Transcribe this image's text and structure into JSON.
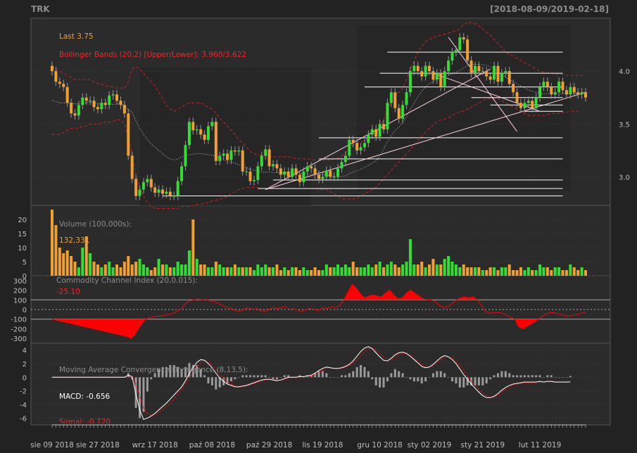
{
  "symbol": "TRK",
  "date_range": "[2018-08-09/2019-02-18]",
  "colors": {
    "bg": "#222222",
    "panel": "#2b2b2b",
    "grid": "#3a3a3a",
    "axis": "#bfbfbf",
    "up": "#33dd33",
    "down": "#f0a030",
    "band": "#cc2222",
    "red": "#ff0000",
    "orange": "#f0a030",
    "white": "#ffffff",
    "gray": "#8c8c8c"
  },
  "legend": {
    "last": "Last 3.75",
    "bbands": "Bollinger Bands (20,2) [Upper/Lower]: 3.960/3.622",
    "volume_title": "Volume (100,000s):",
    "volume_value": "132,331",
    "cci_title": "Commodity Channel Index (20,0.015):",
    "cci_value": "-25.10",
    "macd_title": "Moving Average Convergence Divergence (8,13,5):",
    "macd_value": "MACD: -0.656",
    "signal_value": "Signal: -0.720"
  },
  "x_axis_labels": [
    {
      "label": "sie 09 2018",
      "i": 0
    },
    {
      "label": "sie 27 2018",
      "i": 12
    },
    {
      "label": "wrz 17 2018",
      "i": 27
    },
    {
      "label": "paź 08 2018",
      "i": 42
    },
    {
      "label": "paź 29 2018",
      "i": 57
    },
    {
      "label": "lis 19 2018",
      "i": 71
    },
    {
      "label": "gru 10 2018",
      "i": 86
    },
    {
      "label": "sty 02 2019",
      "i": 99
    },
    {
      "label": "sty 21 2019",
      "i": 113
    },
    {
      "label": "lut 11 2019",
      "i": 128
    }
  ],
  "chart_data": [
    {
      "type": "candlestick",
      "name": "price",
      "ylim": [
        2.73,
        4.5
      ],
      "yticks": [
        3.0,
        3.5,
        4.0
      ],
      "ohlc_closes": [
        4.0,
        3.9,
        3.88,
        3.85,
        3.7,
        3.6,
        3.58,
        3.68,
        3.75,
        3.72,
        3.72,
        3.66,
        3.64,
        3.7,
        3.68,
        3.77,
        3.78,
        3.72,
        3.68,
        3.6,
        3.2,
        2.98,
        2.82,
        2.88,
        2.95,
        2.98,
        2.9,
        2.85,
        2.88,
        2.84,
        2.86,
        2.82,
        2.82,
        2.96,
        3.1,
        3.3,
        3.52,
        3.44,
        3.45,
        3.4,
        3.35,
        3.48,
        3.52,
        3.15,
        3.2,
        3.22,
        3.16,
        3.25,
        3.24,
        3.25,
        3.05,
        3.05,
        2.96,
        2.97,
        3.1,
        3.2,
        3.26,
        3.1,
        3.12,
        3.08,
        3.02,
        3.05,
        3.0,
        3.08,
        3.02,
        2.95,
        3.05,
        3.1,
        3.08,
        3.02,
        2.98,
        3.0,
        3.06,
        3.0,
        3.0,
        3.08,
        3.14,
        3.2,
        3.35,
        3.32,
        3.25,
        3.28,
        3.32,
        3.4,
        3.45,
        3.38,
        3.5,
        3.45,
        3.7,
        3.8,
        3.65,
        3.55,
        3.68,
        3.8,
        4.0,
        4.05,
        4.0,
        3.95,
        4.05,
        4.0,
        3.92,
        3.98,
        3.85,
        4.0,
        4.1,
        4.18,
        4.2,
        4.32,
        4.3,
        4.1,
        3.98,
        4.05,
        4.0,
        4.0,
        3.95,
        3.92,
        4.05,
        3.9,
        3.98,
        4.0,
        3.88,
        3.8,
        3.7,
        3.65,
        3.7,
        3.72,
        3.65,
        3.75,
        3.85,
        3.9,
        3.85,
        3.78,
        3.8,
        3.9,
        3.82,
        3.78,
        3.85,
        3.8,
        3.78,
        3.8,
        3.75
      ],
      "bb_upper": [
        4.05,
        4.02,
        4.0,
        3.98,
        3.96,
        3.94,
        3.92,
        3.92,
        3.92,
        3.92,
        3.92,
        3.9,
        3.88,
        3.88,
        3.86,
        3.86,
        3.85,
        3.84,
        3.84,
        3.84,
        3.9,
        4.02,
        4.04,
        4.02,
        3.98,
        3.94,
        3.9,
        3.86,
        3.8,
        3.74,
        3.68,
        3.64,
        3.62,
        3.64,
        3.66,
        3.68,
        3.7,
        3.7,
        3.7,
        3.7,
        3.68,
        3.66,
        3.64,
        3.6,
        3.56,
        3.52,
        3.48,
        3.44,
        3.4,
        3.35,
        3.32,
        3.28,
        3.24,
        3.22,
        3.21,
        3.2,
        3.2,
        3.2,
        3.19,
        3.19,
        3.19,
        3.19,
        3.19,
        3.18,
        3.18,
        3.17,
        3.17,
        3.17,
        3.16,
        3.16,
        3.16,
        3.16,
        3.16,
        3.16,
        3.17,
        3.18,
        3.2,
        3.23,
        3.27,
        3.3,
        3.32,
        3.33,
        3.34,
        3.36,
        3.38,
        3.4,
        3.46,
        3.54,
        3.64,
        3.72,
        3.78,
        3.8,
        3.84,
        3.92,
        4.02,
        4.1,
        4.18,
        4.24,
        4.28,
        4.3,
        4.32,
        4.33,
        4.34,
        4.35,
        4.36,
        4.37,
        4.38,
        4.4,
        4.44,
        4.46,
        4.46,
        4.45,
        4.43,
        4.4,
        4.37,
        4.34,
        4.3,
        4.26,
        4.22,
        4.18,
        4.16,
        4.14,
        4.12,
        4.1,
        4.08,
        4.06,
        4.04,
        4.02,
        4.0,
        3.99,
        3.98,
        3.98,
        3.97,
        3.97,
        3.97,
        3.96,
        3.96,
        3.96,
        3.96,
        3.96,
        3.96
      ],
      "bb_lower": [
        3.4,
        3.4,
        3.4,
        3.42,
        3.44,
        3.46,
        3.46,
        3.46,
        3.48,
        3.48,
        3.5,
        3.5,
        3.5,
        3.5,
        3.52,
        3.52,
        3.52,
        3.54,
        3.54,
        3.5,
        3.38,
        3.2,
        3.02,
        2.9,
        2.82,
        2.76,
        2.72,
        2.7,
        2.7,
        2.7,
        2.7,
        2.7,
        2.7,
        2.7,
        2.72,
        2.72,
        2.72,
        2.73,
        2.74,
        2.74,
        2.75,
        2.76,
        2.77,
        2.78,
        2.79,
        2.8,
        2.82,
        2.84,
        2.86,
        2.88,
        2.89,
        2.9,
        2.9,
        2.9,
        2.9,
        2.89,
        2.89,
        2.89,
        2.89,
        2.89,
        2.89,
        2.89,
        2.89,
        2.89,
        2.89,
        2.89,
        2.89,
        2.89,
        2.89,
        2.89,
        2.88,
        2.88,
        2.88,
        2.86,
        2.84,
        2.82,
        2.8,
        2.79,
        2.79,
        2.79,
        2.8,
        2.82,
        2.84,
        2.86,
        2.88,
        2.9,
        2.94,
        2.98,
        3.02,
        3.06,
        3.1,
        3.14,
        3.18,
        3.22,
        3.26,
        3.3,
        3.34,
        3.38,
        3.42,
        3.46,
        3.49,
        3.52,
        3.54,
        3.55,
        3.56,
        3.58,
        3.6,
        3.62,
        3.62,
        3.64,
        3.66,
        3.68,
        3.7,
        3.72,
        3.74,
        3.74,
        3.74,
        3.74,
        3.72,
        3.7,
        3.68,
        3.66,
        3.64,
        3.62,
        3.6,
        3.58,
        3.58,
        3.58,
        3.58,
        3.58,
        3.59,
        3.6,
        3.6,
        3.6,
        3.61,
        3.61,
        3.62,
        3.62,
        3.62
      ]
    },
    {
      "type": "bar",
      "name": "volume",
      "ylim": [
        0,
        25
      ],
      "yticks": [
        0,
        5,
        10,
        15,
        20
      ],
      "values": [
        23.5,
        18,
        10,
        8,
        9,
        7,
        5,
        3,
        10,
        14,
        8,
        5,
        4,
        3,
        4,
        5,
        3,
        4,
        3,
        5,
        7,
        4,
        5,
        6,
        4,
        3,
        2,
        3,
        6,
        4,
        4,
        3,
        3,
        5,
        4,
        4,
        9,
        20,
        6,
        4,
        4,
        3,
        3,
        5,
        4,
        3,
        3,
        3,
        4,
        3,
        3,
        3,
        3,
        2,
        4,
        3,
        4,
        3,
        3,
        4,
        2,
        3,
        2,
        3,
        3,
        2,
        3,
        2,
        2,
        3,
        2,
        2,
        4,
        3,
        3,
        4,
        3,
        4,
        3,
        5,
        3,
        3,
        3,
        4,
        3,
        4,
        5,
        3,
        4,
        5,
        4,
        3,
        4,
        5,
        13,
        4,
        4,
        5,
        3,
        4,
        6,
        4,
        4,
        6,
        7,
        5,
        4,
        3,
        4,
        3,
        3,
        3,
        3,
        2,
        2,
        3,
        3,
        2,
        3,
        3,
        4,
        2,
        2,
        3,
        2,
        3,
        2,
        2,
        4,
        3,
        3,
        2,
        3,
        3,
        2,
        2,
        4,
        3,
        2,
        3,
        2
      ],
      "last": 1.32331
    },
    {
      "type": "area",
      "name": "cci",
      "ylim": [
        -350,
        350
      ],
      "yticks": [
        -300,
        -200,
        -100,
        0,
        100,
        200,
        300
      ],
      "lines": [
        100,
        -100
      ],
      "values": [
        -100,
        -110,
        -120,
        -130,
        -140,
        -150,
        -160,
        -170,
        -180,
        -190,
        -200,
        -210,
        -220,
        -230,
        -240,
        -250,
        -260,
        -270,
        -280,
        -300,
        -250,
        -180,
        -120,
        -90,
        -80,
        -70,
        -70,
        -60,
        -50,
        -40,
        -20,
        10,
        60,
        90,
        100,
        110,
        100,
        105,
        90,
        80,
        60,
        40,
        20,
        10,
        -10,
        -20,
        0,
        20,
        0,
        10,
        -10,
        -20,
        0,
        20,
        10,
        20,
        30,
        0,
        10,
        -10,
        -20,
        0,
        10,
        0,
        -10,
        20,
        10,
        30,
        20,
        40,
        100,
        180,
        260,
        220,
        160,
        120,
        140,
        150,
        140,
        130,
        170,
        200,
        150,
        110,
        120,
        170,
        200,
        170,
        140,
        110,
        100,
        100,
        80,
        40,
        20,
        30,
        60,
        100,
        120,
        130,
        120,
        130,
        100,
        40,
        -20,
        -40,
        -30,
        -30,
        -40,
        -60,
        -80,
        -100,
        -180,
        -200,
        -170,
        -150,
        -120,
        -90,
        -60,
        -40,
        -30,
        -40,
        -50,
        -60,
        -70,
        -60,
        -50,
        -40,
        -25
      ],
      "last": -25.1
    },
    {
      "type": "line",
      "name": "macd",
      "ylim": [
        -7,
        5
      ],
      "yticks": [
        -6,
        -4,
        -2,
        0,
        2,
        4
      ],
      "series": [
        {
          "name": "MACD",
          "values": [
            0,
            0,
            0,
            0,
            0,
            0,
            0,
            0,
            0,
            0,
            0,
            0,
            0,
            0,
            0,
            0,
            0,
            0,
            0,
            0,
            0.3,
            0.1,
            -2.5,
            -4.8,
            -6.2,
            -6.0,
            -5.7,
            -5.3,
            -4.8,
            -4.3,
            -3.8,
            -3.2,
            -2.6,
            -2.0,
            -1.4,
            -0.5,
            0.6,
            1.4,
            2.2,
            2.6,
            2.5,
            2.0,
            1.4,
            0.6,
            -0.1,
            -0.6,
            -1.0,
            -1.2,
            -1.4,
            -1.4,
            -1.3,
            -1.2,
            -1.0,
            -0.8,
            -0.6,
            -0.4,
            -0.3,
            -0.3,
            -0.4,
            -0.5,
            -0.4,
            -0.2,
            0.0,
            0.0,
            0.0,
            0.1,
            0.1,
            0.2,
            0.3,
            0.6,
            1.0,
            1.3,
            1.5,
            1.4,
            1.3,
            1.3,
            1.4,
            1.6,
            1.9,
            2.4,
            3.1,
            3.8,
            4.3,
            4.5,
            4.2,
            3.6,
            3.0,
            2.5,
            2.4,
            2.8,
            3.3,
            3.6,
            3.7,
            3.5,
            3.1,
            2.6,
            2.1,
            1.6,
            1.4,
            1.5,
            1.9,
            2.4,
            2.9,
            3.2,
            3.0,
            2.6,
            2.0,
            1.2,
            0.4,
            -0.3,
            -1.0,
            -1.6,
            -2.2,
            -2.7,
            -3.0,
            -3.0,
            -2.8,
            -2.4,
            -1.9,
            -1.5,
            -1.2,
            -1.0,
            -0.9,
            -0.8,
            -0.7,
            -0.7,
            -0.7,
            -0.7,
            -0.6,
            -0.7,
            -0.6,
            -0.6,
            -0.7,
            -0.7,
            -0.7,
            -0.7,
            -0.66
          ]
        },
        {
          "name": "Signal",
          "values": [
            0,
            0,
            0,
            0,
            0,
            0,
            0,
            0,
            0,
            0,
            0,
            0,
            0,
            0,
            0,
            0,
            0,
            0,
            0,
            0,
            0.1,
            0.2,
            -1.0,
            -2.8,
            -4.5,
            -5.3,
            -5.6,
            -5.5,
            -5.2,
            -4.8,
            -4.3,
            -3.8,
            -3.2,
            -2.5,
            -1.8,
            -1.0,
            -0.1,
            0.8,
            1.6,
            2.2,
            2.4,
            2.3,
            1.8,
            1.2,
            0.4,
            -0.2,
            -0.7,
            -1.0,
            -1.3,
            -1.4,
            -1.4,
            -1.3,
            -1.1,
            -0.9,
            -0.7,
            -0.5,
            -0.4,
            -0.3,
            -0.3,
            -0.4,
            -0.4,
            -0.3,
            -0.1,
            0.0,
            0.0,
            0.0,
            0.1,
            0.1,
            0.2,
            0.4,
            0.7,
            1.0,
            1.3,
            1.4,
            1.3,
            1.3,
            1.3,
            1.5,
            1.7,
            2.1,
            2.6,
            3.2,
            3.8,
            4.2,
            4.3,
            4.0,
            3.5,
            3.0,
            2.6,
            2.6,
            2.9,
            3.3,
            3.5,
            3.5,
            3.2,
            2.8,
            2.3,
            1.9,
            1.6,
            1.5,
            1.7,
            2.1,
            2.6,
            3.0,
            3.0,
            2.8,
            2.3,
            1.7,
            0.9,
            0.1,
            -0.6,
            -1.2,
            -1.8,
            -2.3,
            -2.7,
            -2.9,
            -2.9,
            -2.6,
            -2.2,
            -1.8,
            -1.4,
            -1.1,
            -1.0,
            -0.9,
            -0.8,
            -0.8,
            -0.8,
            -0.8,
            -0.7,
            -0.7,
            -0.7,
            -0.7,
            -0.7,
            -0.7,
            -0.7,
            -0.7,
            -0.72
          ]
        }
      ],
      "last_macd": -0.656,
      "last_signal": -0.72
    }
  ]
}
